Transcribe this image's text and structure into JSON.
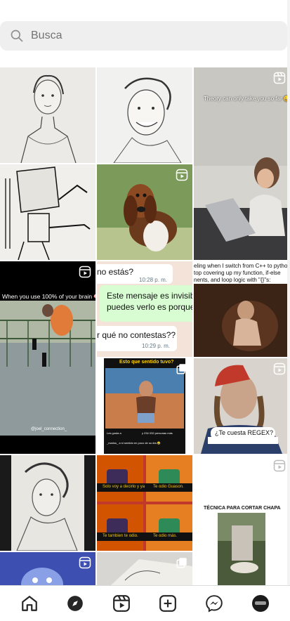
{
  "search": {
    "placeholder": "Busca",
    "value": ""
  },
  "tiles": {
    "t3": {
      "caption": "Theory can only take you so far 😅"
    },
    "t6": {
      "line1": "no estás?",
      "time1": "10:28 p. m.",
      "line2a": "Este mensaje es invisibl",
      "line2b": "puedes verlo es porque",
      "line3": "r qué no contestas??",
      "time3": "10:29 p. m."
    },
    "t7": {
      "line1": "eling when I switch from C++ to pytho",
      "line2": "top covering up my function, if-else",
      "line3": "nents, and loop logic with \"{}\"s:"
    },
    "t8": {
      "caption": "When you use 100% of your brain 🧠",
      "handle": "@joel_connection_"
    },
    "t9": {
      "caption": "Esto que sentido tuvo?",
      "likes": "Les gusta a ",
      "count": "y 234 032 personas más",
      "comment": "_mariss_ a ni sentido en poco de su día 😂"
    },
    "t10": {
      "caption": "¿Te cuesta REGEX?"
    },
    "t12": {
      "sub1": "Solo voy a decirlo y ya",
      "sub2": "Te odio Guason.",
      "sub3": "Te tambien te odio.",
      "sub4": "Te odio más."
    },
    "t13": {
      "title": "TÉCNICA PARA CORTAR CHAPA"
    }
  },
  "nav": {
    "items": [
      "home-icon",
      "explore-icon",
      "reels-icon",
      "create-icon",
      "messenger-icon",
      "profile-avatar"
    ]
  },
  "colors": {
    "accent": "#262626",
    "badge": "#ffffff",
    "chat_green": "#d9fdd3"
  }
}
